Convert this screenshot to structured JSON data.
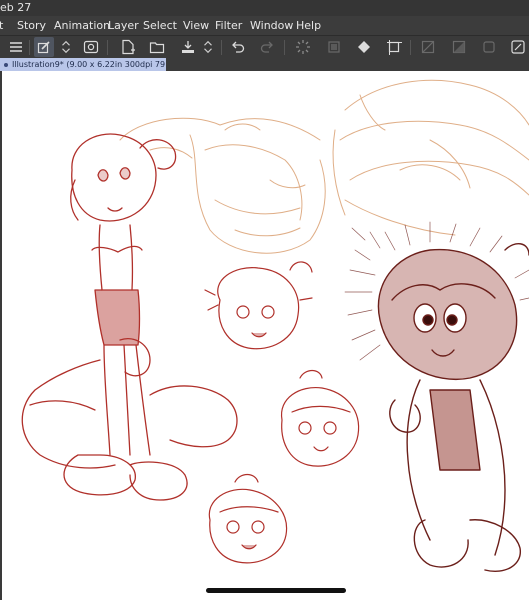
{
  "window": {
    "title": "eb 27"
  },
  "menu": [
    "t",
    "Story",
    "Animation",
    "Layer",
    "Select",
    "View",
    "Filter",
    "Window",
    "Help"
  ],
  "toolbar": {
    "icons": [
      "menu-icon",
      "pen-select-icon",
      "stepper-icon",
      "eye-icon",
      "new-file-icon",
      "open-folder-icon",
      "save-icon",
      "save-stepper-icon",
      "undo-icon",
      "redo-icon",
      "loading-spinner-icon",
      "lasso-icon",
      "fill-icon",
      "transform-icon",
      "hide-icon",
      "clear-icon",
      "grid-icon",
      "more-icon"
    ]
  },
  "document_tab": {
    "label": "Illustration9* (9.00 x 6.22in 300dpi 79.4%)"
  },
  "colors": {
    "sketch_red": "#b0302a",
    "sketch_orange": "#d08a55",
    "sketch_dark": "#6b1f1a"
  }
}
